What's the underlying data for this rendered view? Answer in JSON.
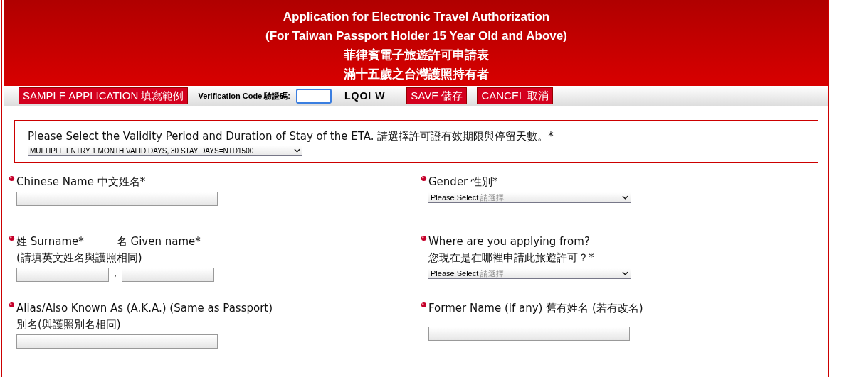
{
  "header": {
    "title_lines": [
      "Application for Electronic Travel Authorization",
      "(For Taiwan Passport Holder 15 Year Old and Above)",
      "菲律賓電子旅遊許可申請表",
      "滿十五歲之台灣護照持有者"
    ]
  },
  "toolbar": {
    "sample_button": "SAMPLE APPLICATION 填寫範例",
    "verification_label": "Verification Code 驗證碼:",
    "verification_input": {
      "focused": true
    },
    "captcha": "LQOI W",
    "save_button": "SAVE 儲存",
    "cancel_button": "CANCEL 取消"
  },
  "validity": {
    "label": "Please Select the Validity Period and Duration of Stay of the ETA. 請選擇許可證有效期限與停留天數。*",
    "value": "MULTIPLE ENTRY 1 MONTH VALID DAYS, 30 STAY DAYS=NTD1500"
  },
  "rows": [
    {
      "left": {
        "kind": "text",
        "label_lines": [
          "Chinese Name 中文姓名*"
        ]
      },
      "right": {
        "kind": "select",
        "label_lines": [
          "Gender 性別*"
        ],
        "placeholder": "Please Select",
        "placeholder_note": "請選擇"
      }
    },
    {
      "left": {
        "kind": "name_pair",
        "surname_label": "姓 Surname*",
        "given_label": "名 Given name*",
        "note": "(請填英文姓名與護照相同)",
        "separator": ","
      },
      "right": {
        "kind": "select",
        "label_lines": [
          "Where are you applying from?",
          "您現在是在哪裡申請此旅遊許可？*"
        ],
        "placeholder": "Please Select",
        "placeholder_note": "請選擇"
      }
    },
    {
      "left": {
        "kind": "text",
        "label_lines": [
          "Alias/Also Known As (A.K.A.) (Same as Passport)",
          "別名(與護照別名相同)"
        ]
      },
      "right": {
        "kind": "text",
        "label_lines": [
          "Former Name (if any) 舊有姓名 (若有改名)"
        ]
      }
    }
  ]
}
